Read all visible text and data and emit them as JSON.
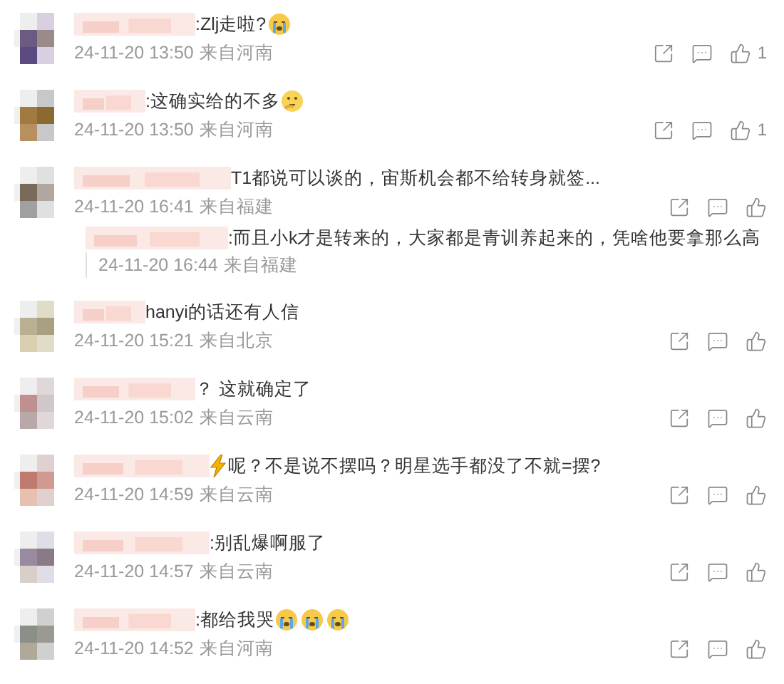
{
  "comments": [
    {
      "parts": [
        {
          "kind": "text",
          "text": ":Zlj走啦?"
        },
        {
          "kind": "cry-emoji"
        }
      ],
      "time": "24-11-20 13:50",
      "location": "来自河南",
      "likes": "1"
    },
    {
      "parts": [
        {
          "kind": "text",
          "text": ":这确实给的不多"
        },
        {
          "kind": "think-emoji"
        }
      ],
      "time": "24-11-20 13:50",
      "location": "来自河南",
      "likes": "1"
    },
    {
      "parts": [
        {
          "kind": "text",
          "text": "T1都说可以谈的，宙斯机会都不给转身就签..."
        }
      ],
      "time": "24-11-20 16:41",
      "location": "来自福建",
      "replies": [
        {
          "parts": [
            {
              "kind": "text",
              "text": ":而且小k才是转来的，大家都是青训养起来的，凭啥他要拿那么高"
            }
          ],
          "time": "24-11-20 16:44",
          "location": "来自福建"
        }
      ]
    },
    {
      "parts": [
        {
          "kind": "text",
          "text": "hanyi的话还有人信"
        }
      ],
      "time": "24-11-20 15:21",
      "location": "来自北京"
    },
    {
      "parts": [
        {
          "kind": "text",
          "text": "？ 这就确定了"
        }
      ],
      "time": "24-11-20 15:02",
      "location": "来自云南"
    },
    {
      "parts": [
        {
          "kind": "bolt-emoji"
        },
        {
          "kind": "text",
          "text": "呢？不是说不摆吗？明星选手都没了不就=摆?"
        }
      ],
      "time": "24-11-20 14:59",
      "location": "来自云南"
    },
    {
      "parts": [
        {
          "kind": "text",
          "text": ":别乱爆啊服了"
        }
      ],
      "time": "24-11-20 14:57",
      "location": "来自云南"
    },
    {
      "parts": [
        {
          "kind": "text",
          "text": ":都给我哭"
        },
        {
          "kind": "cry-emoji"
        },
        {
          "kind": "cry-emoji"
        },
        {
          "kind": "cry-emoji"
        }
      ],
      "time": "24-11-20 14:52",
      "location": "来自河南"
    }
  ]
}
